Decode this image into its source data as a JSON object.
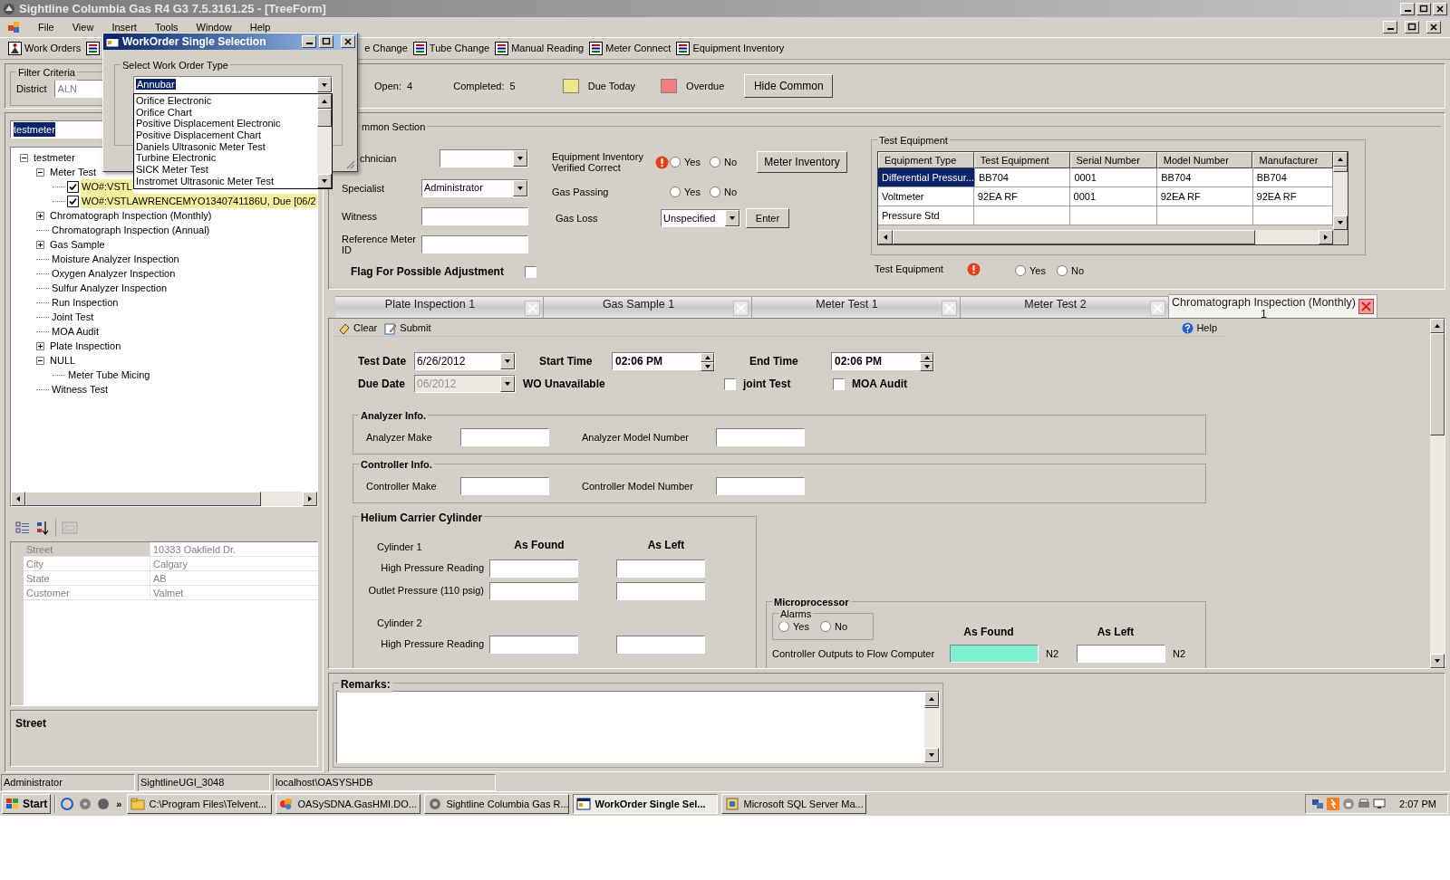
{
  "window": {
    "title": "Sightline Columbia Gas R4 G3 7.5.3161.25 - [TreeForm]"
  },
  "menu": [
    {
      "label": "File"
    },
    {
      "label": "View"
    },
    {
      "label": "Insert"
    },
    {
      "label": "Tools"
    },
    {
      "label": "Window"
    },
    {
      "label": "Help"
    }
  ],
  "toolbar": [
    {
      "label": "Work Orders",
      "kind": "work_orders"
    },
    {
      "kind": "list"
    },
    {
      "label": "e Change",
      "kind": "text"
    },
    {
      "label": "Tube Change",
      "kind": "list"
    },
    {
      "label": "Manual Reading",
      "kind": "list"
    },
    {
      "label": "Meter Connect",
      "kind": "list"
    },
    {
      "label": "Equipment Inventory",
      "kind": "list"
    }
  ],
  "filter": {
    "title": "Filter Criteria",
    "district_label": "District",
    "district_value": "ALN",
    "open": "Open:  4",
    "completed": "Completed:  5",
    "legend": [
      {
        "label": "Due Today",
        "color": "#f0e68c"
      },
      {
        "label": "Overdue",
        "color": "#f08080"
      }
    ],
    "hide_button": "Hide Common"
  },
  "dialog": {
    "title": "WorkOrder Single Selection",
    "group": "Select Work Order Type",
    "value": "Annubar",
    "options": [
      "Orifice Electronic",
      "Orifice Chart",
      "Positive Displacement Electronic",
      "Positive Displacement Chart",
      "Daniels Ultrasonic Meter Test",
      "Turbine Electronic",
      "SICK Meter Test",
      "Instromet Ultrasonic Meter Test"
    ]
  },
  "search": {
    "value": "testmeter"
  },
  "tree": [
    {
      "label": "testmeter",
      "expanded": true,
      "children": [
        {
          "label": "Meter Test",
          "expanded": true,
          "children": [
            {
              "label": "WO#:VSTL",
              "kind": "work_order",
              "checked": true,
              "highlighted": true
            },
            {
              "label": "WO#:VSTLAWRENCEMYO1340741186U, Due [06/2",
              "kind": "work_order",
              "checked": true,
              "highlighted": true
            }
          ]
        },
        {
          "label": "Chromatograph Inspection (Monthly)",
          "expanded": false
        },
        {
          "label": "Chromatograph Inspection (Annual)"
        },
        {
          "label": "Gas Sample",
          "expanded": false
        },
        {
          "label": "Moisture Analyzer Inspection"
        },
        {
          "label": "Oxygen Analyzer Inspection"
        },
        {
          "label": "Sulfur Analyzer Inspection"
        },
        {
          "label": "Run Inspection"
        },
        {
          "label": "Joint Test"
        },
        {
          "label": "MOA Audit"
        },
        {
          "label": "Plate Inspection",
          "expanded": false
        },
        {
          "label": "NULL",
          "expanded": true,
          "children": [
            {
              "label": "Meter Tube Micing"
            }
          ]
        },
        {
          "label": "Witness Test"
        }
      ]
    }
  ],
  "properties": {
    "rows": [
      {
        "name": "Street",
        "value": "10333 Oakfield Dr.",
        "selected": true
      },
      {
        "name": "City",
        "value": "Calgary",
        "selected": false
      },
      {
        "name": "State",
        "value": "AB",
        "selected": false
      },
      {
        "name": "Customer",
        "value": "Valmet",
        "selected": false
      }
    ],
    "description": "Street"
  },
  "common": {
    "title": "mmon Section",
    "fields": [
      {
        "label": "chnician",
        "kind": "combo"
      },
      {
        "label": "Specialist",
        "kind": "combo",
        "value": "Administrator"
      },
      {
        "label": "Witness",
        "kind": "text"
      },
      {
        "label": "Reference Meter ID",
        "kind": "text"
      }
    ],
    "flag": {
      "label": "Flag For Possible Adjustment",
      "checked": false
    },
    "questions": [
      {
        "label": "Equipment Inventory Verified Correct",
        "warning": true,
        "options": [
          {
            "label": "Yes",
            "selected": false
          },
          {
            "label": "No",
            "selected": false
          }
        ]
      },
      {
        "label": "Gas Passing",
        "warning": false,
        "options": [
          {
            "label": "Yes",
            "selected": false
          },
          {
            "label": "No",
            "selected": false
          }
        ]
      }
    ],
    "meter_inventory_button": "Meter Inventory",
    "gas_loss": {
      "label": "Gas Loss",
      "value": "Unspecified",
      "button": "Enter"
    },
    "test_equipment": {
      "title": "Test Equipment",
      "columns": [
        "Equipment Type",
        "Test Equipment",
        "Serial Number",
        "Model Number",
        "Manufacturer"
      ],
      "rows": [
        {
          "cells": [
            "Differential Pressur...",
            "BB704",
            "0001",
            "BB704",
            "BB704"
          ],
          "selected": true
        },
        {
          "cells": [
            "Voltmeter",
            "92EA RF",
            "0001",
            "92EA RF",
            "92EA RF"
          ],
          "selected": false
        },
        {
          "cells": [
            "Pressure Std"
          ],
          "selected": false
        }
      ],
      "label": "Test Equipment",
      "warning": true,
      "options": [
        {
          "label": "Yes",
          "selected": false
        },
        {
          "label": "No",
          "selected": false
        }
      ]
    }
  },
  "tabs": [
    {
      "label": "Plate Inspection 1",
      "selected": false
    },
    {
      "label": "Gas Sample 1",
      "selected": false
    },
    {
      "label": "Meter Test 1",
      "selected": false
    },
    {
      "label": "Meter Test 2",
      "selected": false
    },
    {
      "label": "Chromatograph Inspection (Monthly)\n1",
      "selected": true
    }
  ],
  "form": {
    "actions": [
      {
        "label": "Clear",
        "kind": "clear"
      },
      {
        "label": "Submit",
        "kind": "submit"
      }
    ],
    "help": "Help",
    "test_date": {
      "label": "Test Date",
      "value": "6/26/2012"
    },
    "start_time": {
      "label": "Start Time",
      "value": "02:06 PM"
    },
    "end_time": {
      "label": "End Time",
      "value": "02:06 PM"
    },
    "due_date": {
      "label": "Due Date",
      "value": "06/2012",
      "disabled": true
    },
    "wo_status": "WO Unavailable",
    "checks": [
      {
        "label": "joint Test",
        "checked": false
      },
      {
        "label": "MOA Audit",
        "checked": false
      }
    ],
    "groups": [
      {
        "title": "Analyzer Info.",
        "fields": [
          "Analyzer Make",
          "Analyzer Model Number"
        ]
      },
      {
        "title": "Controller Info.",
        "fields": [
          "Controller Make",
          "Controller Model Number"
        ]
      }
    ],
    "helium": {
      "title": "Helium Carrier Cylinder",
      "headers": [
        "As Found",
        "As Left"
      ],
      "rows": [
        {
          "kind": "heading",
          "label": "Cylinder 1"
        },
        {
          "kind": "reading",
          "label": "High Pressure Reading"
        },
        {
          "kind": "reading",
          "label": "Outlet Pressure (110 psig)"
        },
        {
          "kind": "heading",
          "label": "Cylinder 2"
        },
        {
          "kind": "reading",
          "label": "High Pressure Reading"
        }
      ]
    },
    "micro": {
      "title": "Microprocessor",
      "alarms": {
        "title": "Alarms",
        "options": [
          {
            "label": "Yes",
            "selected": false
          },
          {
            "label": "No",
            "selected": false
          }
        ]
      },
      "headers": [
        "As Found",
        "As Left"
      ],
      "row": {
        "label": "Controller Outputs to Flow Computer",
        "found_highlighted": true,
        "found_unit": "N2",
        "left_unit": "N2"
      }
    }
  },
  "remarks": {
    "title": "Remarks:"
  },
  "status_bar": [
    "Administrator",
    "SightlineUGI_3048",
    "localhost\\OASYSHDB"
  ],
  "taskbar": {
    "start": "Start",
    "more": "»",
    "tasks": [
      {
        "label": "C:\\Program Files\\Telvent...",
        "kind": "folder",
        "selected": false
      },
      {
        "label": "OASySDNA.GasHMI.DO...",
        "kind": "app",
        "selected": false
      },
      {
        "label": "Sightline Columbia Gas R...",
        "kind": "gear",
        "selected": false
      },
      {
        "label": "WorkOrder Single Sel...",
        "kind": "window",
        "selected": true
      },
      {
        "label": "Microsoft SQL Server Ma...",
        "kind": "db",
        "selected": false
      }
    ],
    "clock": "2:07 PM"
  }
}
